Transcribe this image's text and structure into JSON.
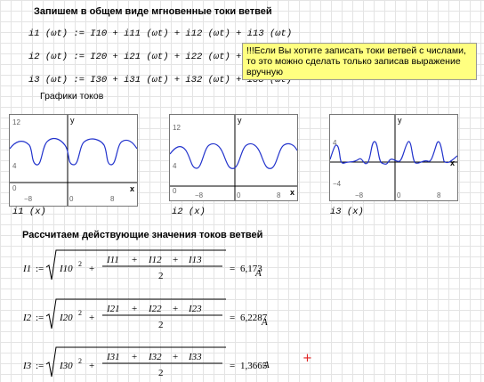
{
  "heading_instant": "Запишем в общем виде мгновенные токи ветвей",
  "formulas": [
    "i1 (ωt) := I10 + i11 (ωt) + i12 (ωt) + i13 (ωt)",
    "i2 (ωt) := I20 + i21 (ωt) + i22 (ωt) + i23 (ωt)",
    "i3 (ωt) := I30 + i31 (ωt) + i32 (ωt) + i33 (ωt)"
  ],
  "note_text": "!!!Если Вы хотите записать токи ветвей с числами, то это можно сделать только записав выражение вручную",
  "graphs_caption": "Графики токов",
  "plots": [
    {
      "label": "i1 (x)",
      "y_axis_name": "y",
      "x_axis_name": "x",
      "y_ticks": [
        "12",
        "4",
        "0"
      ],
      "x_ticks": [
        "−8",
        "0",
        "8"
      ]
    },
    {
      "label": "i2 (x)",
      "y_axis_name": "y",
      "x_axis_name": "x",
      "y_ticks": [
        "12",
        "4",
        "0"
      ],
      "x_ticks": [
        "−8",
        "0",
        "8"
      ]
    },
    {
      "label": "i3 (x)",
      "y_axis_name": "y",
      "x_axis_name": "x",
      "y_ticks": [
        "4",
        "−4"
      ],
      "x_ticks": [
        "−8",
        "0",
        "8"
      ]
    }
  ],
  "heading_rms": "Рассчитаем действующие значения токов ветвей",
  "rms": [
    {
      "lhs": "I1",
      "dc": "I10",
      "a": "I11",
      "b": "I12",
      "c": "I13",
      "value": "6,173",
      "unit": "A"
    },
    {
      "lhs": "I2",
      "dc": "I20",
      "a": "I21",
      "b": "I22",
      "c": "I23",
      "value": "6,2287",
      "unit": "A"
    },
    {
      "lhs": "I3",
      "dc": "I30",
      "a": "I31",
      "b": "I32",
      "c": "I33",
      "value": "1,3665",
      "unit": "A"
    }
  ],
  "rms_symbols": {
    "assign": ":=",
    "plus": "+",
    "equals": "=",
    "square": "2",
    "denominator": "2"
  },
  "cursor_glyph": "+",
  "colors": {
    "curve": "#2233cc",
    "note_bg": "#ffff80",
    "cursor": "#e02020"
  }
}
